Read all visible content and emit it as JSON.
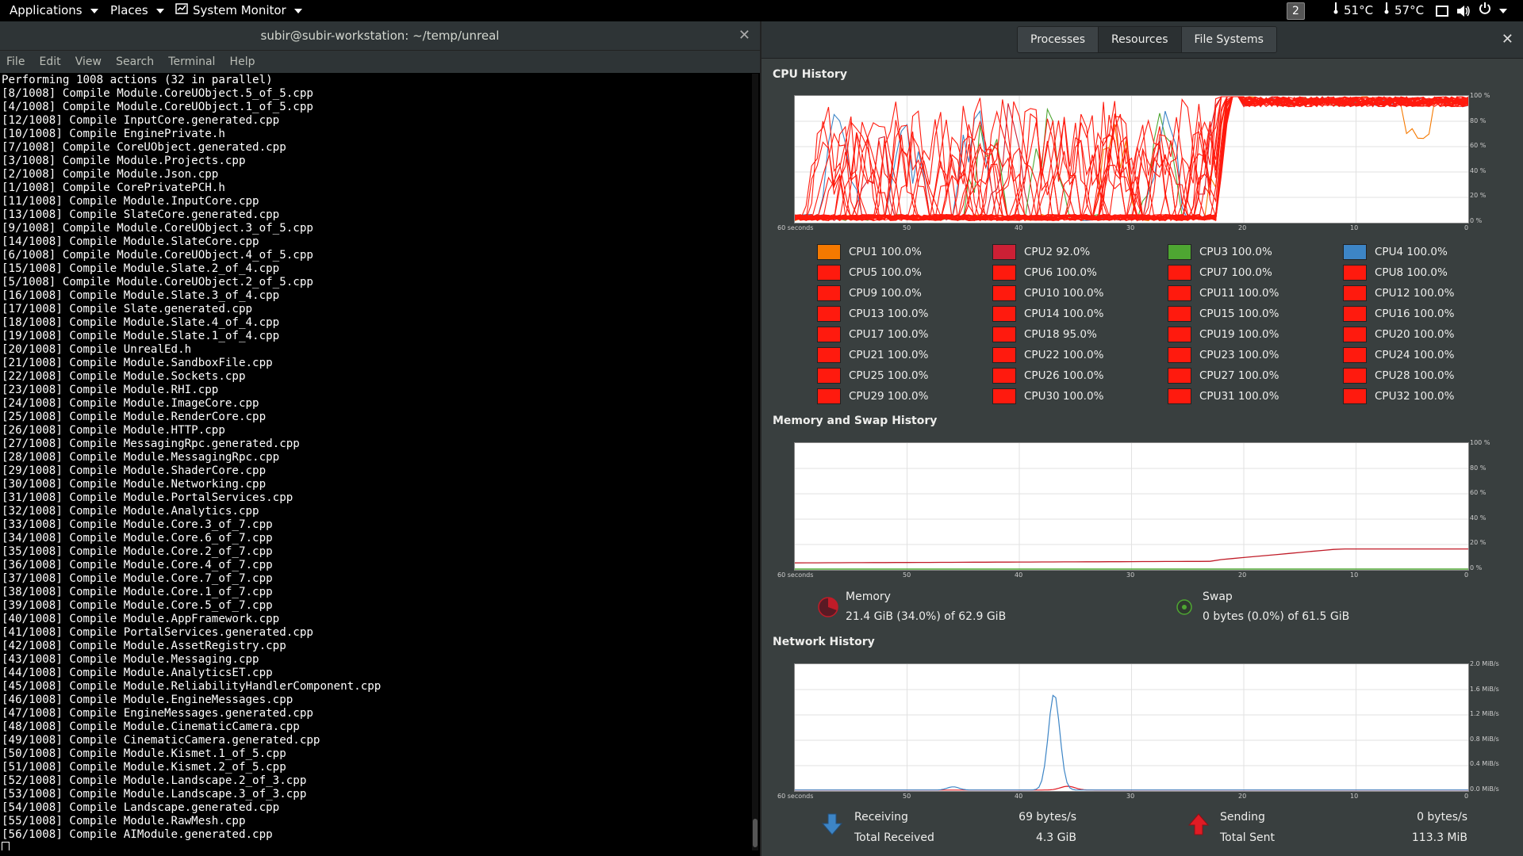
{
  "topbar": {
    "applications": "Applications",
    "places": "Places",
    "system_monitor": "System Monitor",
    "workspace": "2",
    "temp1": "51°C",
    "temp2": "57°C"
  },
  "terminal": {
    "title": "subir@subir-workstation: ~/temp/unreal",
    "menu": [
      "File",
      "Edit",
      "View",
      "Search",
      "Terminal",
      "Help"
    ],
    "lines": [
      "Performing 1008 actions (32 in parallel)",
      "[8/1008] Compile Module.CoreUObject.5_of_5.cpp",
      "[4/1008] Compile Module.CoreUObject.1_of_5.cpp",
      "[12/1008] Compile InputCore.generated.cpp",
      "[10/1008] Compile EnginePrivate.h",
      "[7/1008] Compile CoreUObject.generated.cpp",
      "[3/1008] Compile Module.Projects.cpp",
      "[2/1008] Compile Module.Json.cpp",
      "[1/1008] Compile CorePrivatePCH.h",
      "[11/1008] Compile Module.InputCore.cpp",
      "[13/1008] Compile SlateCore.generated.cpp",
      "[9/1008] Compile Module.CoreUObject.3_of_5.cpp",
      "[14/1008] Compile Module.SlateCore.cpp",
      "[6/1008] Compile Module.CoreUObject.4_of_5.cpp",
      "[15/1008] Compile Module.Slate.2_of_4.cpp",
      "[5/1008] Compile Module.CoreUObject.2_of_5.cpp",
      "[16/1008] Compile Module.Slate.3_of_4.cpp",
      "[17/1008] Compile Slate.generated.cpp",
      "[18/1008] Compile Module.Slate.4_of_4.cpp",
      "[19/1008] Compile Module.Slate.1_of_4.cpp",
      "[20/1008] Compile UnrealEd.h",
      "[21/1008] Compile Module.SandboxFile.cpp",
      "[22/1008] Compile Module.Sockets.cpp",
      "[23/1008] Compile Module.RHI.cpp",
      "[24/1008] Compile Module.ImageCore.cpp",
      "[25/1008] Compile Module.RenderCore.cpp",
      "[26/1008] Compile Module.HTTP.cpp",
      "[27/1008] Compile MessagingRpc.generated.cpp",
      "[28/1008] Compile Module.MessagingRpc.cpp",
      "[29/1008] Compile Module.ShaderCore.cpp",
      "[30/1008] Compile Module.Networking.cpp",
      "[31/1008] Compile Module.PortalServices.cpp",
      "[32/1008] Compile Module.Analytics.cpp",
      "[33/1008] Compile Module.Core.3_of_7.cpp",
      "[34/1008] Compile Module.Core.6_of_7.cpp",
      "[35/1008] Compile Module.Core.2_of_7.cpp",
      "[36/1008] Compile Module.Core.4_of_7.cpp",
      "[37/1008] Compile Module.Core.7_of_7.cpp",
      "[38/1008] Compile Module.Core.1_of_7.cpp",
      "[39/1008] Compile Module.Core.5_of_7.cpp",
      "[40/1008] Compile Module.AppFramework.cpp",
      "[41/1008] Compile PortalServices.generated.cpp",
      "[42/1008] Compile Module.AssetRegistry.cpp",
      "[43/1008] Compile Module.Messaging.cpp",
      "[44/1008] Compile Module.AnalyticsET.cpp",
      "[45/1008] Compile Module.ReliabilityHandlerComponent.cpp",
      "[46/1008] Compile Module.EngineMessages.cpp",
      "[47/1008] Compile EngineMessages.generated.cpp",
      "[48/1008] Compile Module.CinematicCamera.cpp",
      "[49/1008] Compile CinematicCamera.generated.cpp",
      "[50/1008] Compile Module.Kismet.1_of_5.cpp",
      "[51/1008] Compile Module.Kismet.2_of_5.cpp",
      "[52/1008] Compile Module.Landscape.2_of_3.cpp",
      "[53/1008] Compile Module.Landscape.3_of_3.cpp",
      "[54/1008] Compile Landscape.generated.cpp",
      "[55/1008] Compile Module.RawMesh.cpp",
      "[56/1008] Compile AIModule.generated.cpp"
    ]
  },
  "sysmon": {
    "tabs": [
      "Processes",
      "Resources",
      "File Systems"
    ],
    "active_tab": "Resources",
    "cpu_title": "CPU History",
    "mem_title": "Memory and Swap History",
    "net_title": "Network History",
    "x_ticks": [
      "60 seconds",
      "50",
      "40",
      "30",
      "20",
      "10",
      "0"
    ],
    "pct_ticks": [
      "100 %",
      "80 %",
      "60 %",
      "40 %",
      "20 %",
      "0 %"
    ],
    "net_ticks": [
      "2.0 MiB/s",
      "1.6 MiB/s",
      "1.2 MiB/s",
      "0.8 MiB/s",
      "0.4 MiB/s",
      "0.0 MiB/s"
    ],
    "cpus": [
      {
        "label": "CPU1 100.0%",
        "color": "#f57900"
      },
      {
        "label": "CPU2 92.0%",
        "color": "#cc2035"
      },
      {
        "label": "CPU3 100.0%",
        "color": "#4ea632"
      },
      {
        "label": "CPU4 100.0%",
        "color": "#3d85c6"
      },
      {
        "label": "CPU5 100.0%",
        "color": "#ff1a0e"
      },
      {
        "label": "CPU6 100.0%",
        "color": "#ff1a0e"
      },
      {
        "label": "CPU7 100.0%",
        "color": "#ff1a0e"
      },
      {
        "label": "CPU8 100.0%",
        "color": "#ff1a0e"
      },
      {
        "label": "CPU9 100.0%",
        "color": "#ff1a0e"
      },
      {
        "label": "CPU10 100.0%",
        "color": "#ff1a0e"
      },
      {
        "label": "CPU11 100.0%",
        "color": "#ff1a0e"
      },
      {
        "label": "CPU12 100.0%",
        "color": "#ff1a0e"
      },
      {
        "label": "CPU13 100.0%",
        "color": "#ff1a0e"
      },
      {
        "label": "CPU14 100.0%",
        "color": "#ff1a0e"
      },
      {
        "label": "CPU15 100.0%",
        "color": "#ff1a0e"
      },
      {
        "label": "CPU16 100.0%",
        "color": "#ff1a0e"
      },
      {
        "label": "CPU17 100.0%",
        "color": "#ff1a0e"
      },
      {
        "label": "CPU18 95.0%",
        "color": "#ff1a0e"
      },
      {
        "label": "CPU19 100.0%",
        "color": "#ff1a0e"
      },
      {
        "label": "CPU20 100.0%",
        "color": "#ff1a0e"
      },
      {
        "label": "CPU21 100.0%",
        "color": "#ff1a0e"
      },
      {
        "label": "CPU22 100.0%",
        "color": "#ff1a0e"
      },
      {
        "label": "CPU23 100.0%",
        "color": "#ff1a0e"
      },
      {
        "label": "CPU24 100.0%",
        "color": "#ff1a0e"
      },
      {
        "label": "CPU25 100.0%",
        "color": "#ff1a0e"
      },
      {
        "label": "CPU26 100.0%",
        "color": "#ff1a0e"
      },
      {
        "label": "CPU27 100.0%",
        "color": "#ff1a0e"
      },
      {
        "label": "CPU28 100.0%",
        "color": "#ff1a0e"
      },
      {
        "label": "CPU29 100.0%",
        "color": "#ff1a0e"
      },
      {
        "label": "CPU30 100.0%",
        "color": "#ff1a0e"
      },
      {
        "label": "CPU31 100.0%",
        "color": "#ff1a0e"
      },
      {
        "label": "CPU32 100.0%",
        "color": "#ff1a0e"
      }
    ],
    "memory": {
      "label": "Memory",
      "value": "21.4 GiB (34.0%) of 62.9 GiB",
      "color": "#c01c28"
    },
    "swap": {
      "label": "Swap",
      "value": "0 bytes (0.0%) of 61.5 GiB",
      "color": "#4ea632"
    },
    "network": {
      "receiving_label": "Receiving",
      "receiving_rate": "69 bytes/s",
      "total_received_label": "Total Received",
      "total_received": "4.3 GiB",
      "sending_label": "Sending",
      "sending_rate": "0 bytes/s",
      "total_sent_label": "Total Sent",
      "total_sent": "113.3 MiB",
      "receive_color": "#3d85c6",
      "send_color": "#e01b24"
    }
  }
}
